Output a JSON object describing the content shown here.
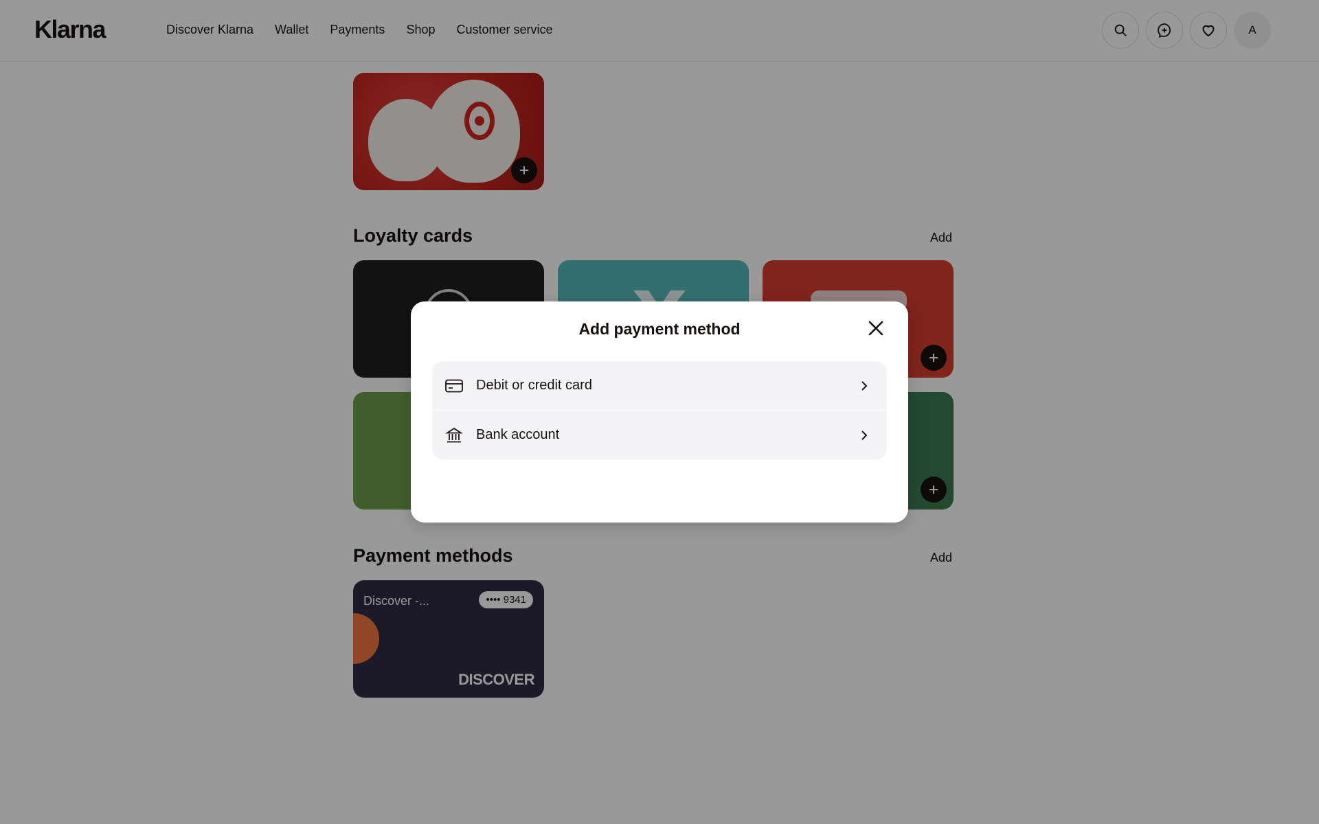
{
  "header": {
    "logo": "Klarna",
    "nav": [
      "Discover Klarna",
      "Wallet",
      "Payments",
      "Shop",
      "Customer service"
    ],
    "avatar_letter": "A"
  },
  "sections": {
    "loyalty_title": "Loyalty cards",
    "loyalty_add": "Add",
    "payments_title": "Payment methods",
    "payments_add": "Add"
  },
  "payment_card": {
    "name": "Discover -...",
    "digits": "•••• 9341",
    "brand": "DISCOVER"
  },
  "modal": {
    "title": "Add payment method",
    "options": [
      {
        "label": "Debit or credit card",
        "icon": "credit-card-icon"
      },
      {
        "label": "Bank account",
        "icon": "bank-icon"
      }
    ]
  },
  "colors": {
    "overlay": "rgba(0,0,0,0.4)",
    "payment_card_bg": "#2f2c45",
    "discover_orange": "#f07541"
  }
}
